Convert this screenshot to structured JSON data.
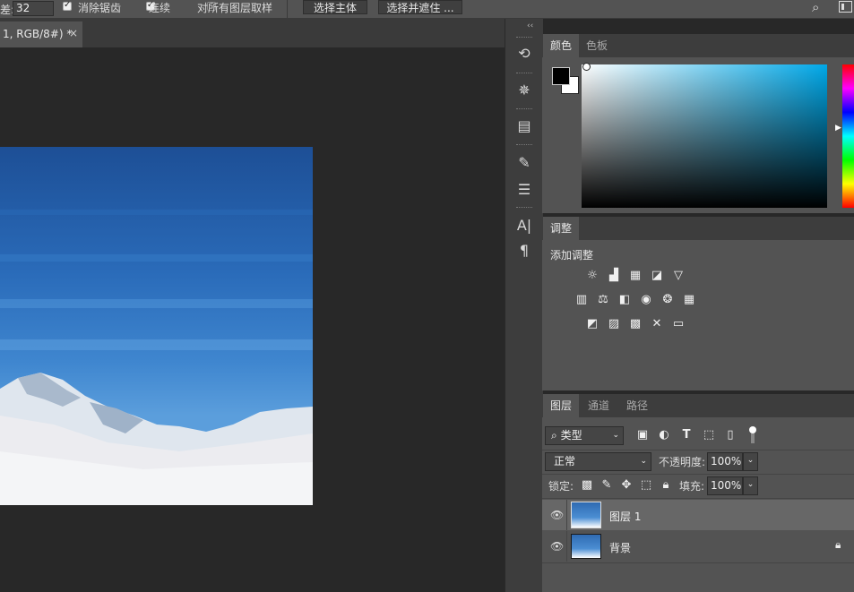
{
  "options_bar": {
    "tolerance_label": "差:",
    "tolerance_value": "32",
    "antialias_label": "消除锯齿",
    "contiguous_label": "连续",
    "sample_all_layers_label": "对所有图层取样",
    "select_subject_label": "选择主体",
    "select_and_mask_label": "选择并遮住 ..."
  },
  "document": {
    "tab_title": "1, RGB/8#) *",
    "close_glyph": "×"
  },
  "icon_strip": {
    "collapse_glyph": "‹‹",
    "icons": [
      "history-icon",
      "settings-icon",
      "properties-icon",
      "brush-icon",
      "brush-settings-icon",
      "character-icon",
      "paragraph-icon"
    ]
  },
  "color_panel": {
    "tabs": [
      "颜色",
      "色板"
    ],
    "active_tab": 0,
    "foreground": "#000000",
    "background": "#ffffff"
  },
  "adjustments_panel": {
    "tab": "调整",
    "heading": "添加调整",
    "rows": [
      [
        "brightness-contrast-icon",
        "levels-icon",
        "curves-icon",
        "exposure-icon",
        "vibrance-icon"
      ],
      [
        "hue-saturation-icon",
        "color-balance-icon",
        "black-white-icon",
        "photo-filter-icon",
        "channel-mixer-icon",
        "color-lookup-icon"
      ],
      [
        "invert-icon",
        "posterize-icon",
        "threshold-icon",
        "selective-color-icon",
        "gradient-map-icon"
      ]
    ]
  },
  "layers_panel": {
    "tabs": [
      "图层",
      "通道",
      "路径"
    ],
    "active_tab": 0,
    "filter_kind": "类型",
    "blend_mode": "正常",
    "opacity_label": "不透明度:",
    "opacity_value": "100%",
    "lock_label": "锁定:",
    "fill_label": "填充:",
    "fill_value": "100%",
    "layers": [
      {
        "name": "图层 1",
        "visible": true,
        "selected": true,
        "locked": false
      },
      {
        "name": "背景",
        "visible": true,
        "selected": false,
        "locked": true
      }
    ]
  },
  "colors": {
    "app_bg": "#282828",
    "panel": "#535353",
    "sky_top": "#1d4f96",
    "sky_bottom": "#5b9edc"
  }
}
